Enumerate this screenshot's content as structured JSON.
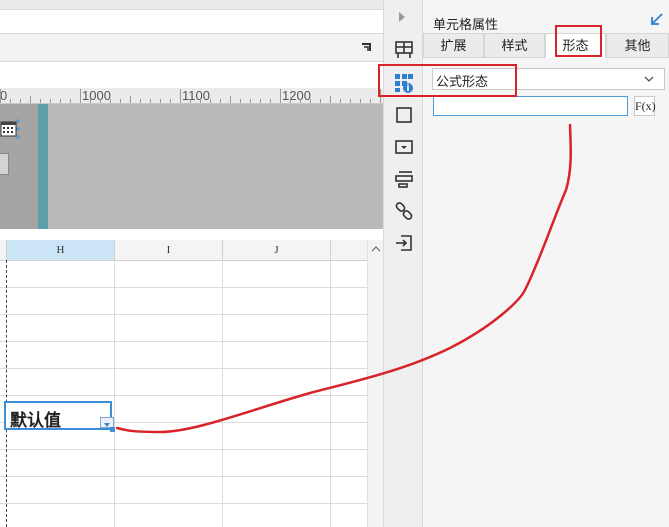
{
  "ruler": {
    "labels": [
      "0",
      "1000",
      "1100",
      "1200"
    ]
  },
  "sheet": {
    "columns": [
      "H",
      "I",
      "J"
    ],
    "selected_cell_value": "默认值",
    "scroll_up_icon": "triangle-up-icon"
  },
  "icon_column": {
    "icons": [
      "collapse-arrow-icon",
      "cell-attributes-icon",
      "widget-attributes-icon",
      "frame-icon",
      "dropdown-icon",
      "layout-icon",
      "link-icon",
      "import-icon"
    ]
  },
  "panel": {
    "title": "单元格属性",
    "tabs": [
      {
        "label": "扩展"
      },
      {
        "label": "样式"
      },
      {
        "label": "形态"
      },
      {
        "label": "其他"
      }
    ],
    "active_tab": "形态",
    "select_value": "公式形态",
    "formula_value": "",
    "fx_label": "F(x)"
  },
  "colors": {
    "annotation": "#d8232a",
    "selection": "#3b8fd6",
    "accent": "#2f7fd0"
  }
}
